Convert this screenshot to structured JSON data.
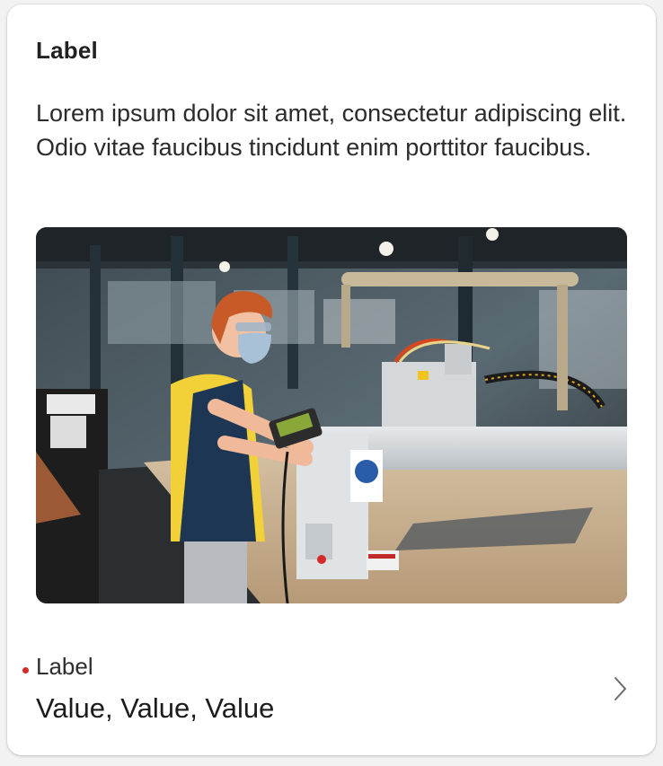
{
  "card": {
    "title": "Label",
    "description": "Lorem ipsum dolor sit amet, consectetur adipiscing elit. Odio vitae faucibus tincidunt enim porttitor faucibus.",
    "image_icon": "factory-worker-photo",
    "field": {
      "label": "Label",
      "value": "Value, Value, Value",
      "required": true,
      "required_color": "#d62828",
      "chevron_icon": "chevron-right-icon"
    }
  }
}
